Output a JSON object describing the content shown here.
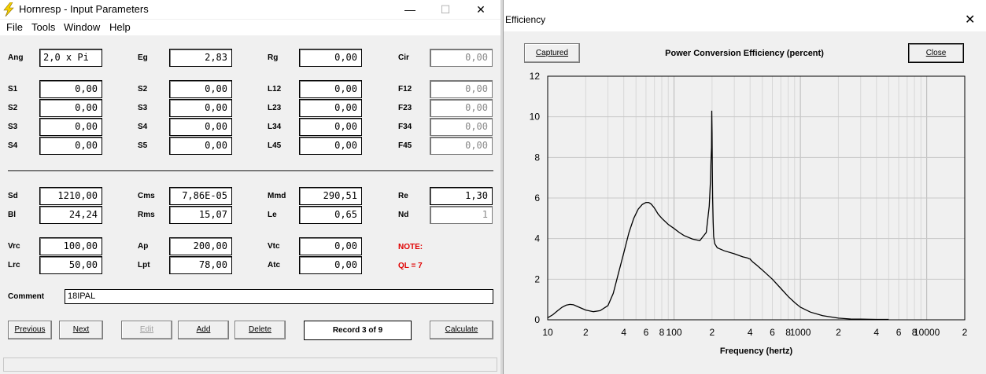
{
  "hornresp": {
    "title": "Hornresp - Input Parameters",
    "menu": [
      "File",
      "Tools",
      "Window",
      "Help"
    ],
    "controls": {
      "minimize": "—",
      "maximize": "☐",
      "close": "✕"
    },
    "rows": [
      {
        "cells": [
          {
            "label": "Ang",
            "value": "2,0 x Pi",
            "disabled": false,
            "left": true
          },
          {
            "label": "Eg",
            "value": "2,83",
            "disabled": false
          },
          {
            "label": "Rg",
            "value": "0,00",
            "disabled": false
          },
          {
            "label": "Cir",
            "value": "0,00",
            "disabled": true
          }
        ]
      },
      {
        "cells": [
          {
            "label": "S1",
            "value": "0,00",
            "disabled": false
          },
          {
            "label": "S2",
            "value": "0,00",
            "disabled": false
          },
          {
            "label": "L12",
            "value": "0,00",
            "disabled": false
          },
          {
            "label": "F12",
            "value": "0,00",
            "disabled": true
          }
        ]
      },
      {
        "cells": [
          {
            "label": "S2",
            "value": "0,00",
            "disabled": false
          },
          {
            "label": "S3",
            "value": "0,00",
            "disabled": false
          },
          {
            "label": "L23",
            "value": "0,00",
            "disabled": false
          },
          {
            "label": "F23",
            "value": "0,00",
            "disabled": true
          }
        ]
      },
      {
        "cells": [
          {
            "label": "S3",
            "value": "0,00",
            "disabled": false
          },
          {
            "label": "S4",
            "value": "0,00",
            "disabled": false
          },
          {
            "label": "L34",
            "value": "0,00",
            "disabled": false
          },
          {
            "label": "F34",
            "value": "0,00",
            "disabled": true
          }
        ]
      },
      {
        "cells": [
          {
            "label": "S4",
            "value": "0,00",
            "disabled": false
          },
          {
            "label": "S5",
            "value": "0,00",
            "disabled": false
          },
          {
            "label": "L45",
            "value": "0,00",
            "disabled": false
          },
          {
            "label": "F45",
            "value": "0,00",
            "disabled": true
          }
        ]
      },
      {
        "cells": [
          {
            "label": "Sd",
            "value": "1210,00",
            "disabled": false
          },
          {
            "label": "Cms",
            "value": "7,86E-05",
            "disabled": false
          },
          {
            "label": "Mmd",
            "value": "290,51",
            "disabled": false
          },
          {
            "label": "Re",
            "value": "1,30",
            "disabled": false
          }
        ]
      },
      {
        "cells": [
          {
            "label": "Bl",
            "value": "24,24",
            "disabled": false
          },
          {
            "label": "Rms",
            "value": "15,07",
            "disabled": false
          },
          {
            "label": "Le",
            "value": "0,65",
            "disabled": false
          },
          {
            "label": "Nd",
            "value": "1",
            "disabled": true
          }
        ]
      },
      {
        "cells": [
          {
            "label": "Vrc",
            "value": "100,00",
            "disabled": false
          },
          {
            "label": "Ap",
            "value": "200,00",
            "disabled": false
          },
          {
            "label": "Vtc",
            "value": "0,00",
            "disabled": false
          },
          {
            "label": "NOTE:",
            "note": true
          }
        ]
      },
      {
        "cells": [
          {
            "label": "Lrc",
            "value": "50,00",
            "disabled": false
          },
          {
            "label": "Lpt",
            "value": "78,00",
            "disabled": false
          },
          {
            "label": "Atc",
            "value": "0,00",
            "disabled": false
          },
          {
            "label": "QL = 7",
            "note": true
          }
        ]
      }
    ],
    "comment_label": "Comment",
    "comment_value": "18IPAL",
    "buttons": {
      "previous": "Previous",
      "next": "Next",
      "edit": "Edit",
      "add": "Add",
      "delete": "Delete",
      "calculate": "Calculate"
    },
    "record": "Record 3 of 9"
  },
  "efficiency": {
    "title": "Efficiency",
    "captured_label": "Captured",
    "close_label": "Close",
    "close_x": "✕"
  },
  "chart_data": {
    "type": "line",
    "title": "Power Conversion Efficiency (percent)",
    "xlabel": "Frequency (hertz)",
    "ylabel": "",
    "x_scale": "log",
    "xlim": [
      10,
      20000
    ],
    "ylim": [
      0,
      12
    ],
    "grid": true,
    "yticks": [
      0,
      2,
      4,
      6,
      8,
      10,
      12
    ],
    "xtick_labels": [
      {
        "value": 10,
        "label": "10"
      },
      {
        "value": 20,
        "label": "2"
      },
      {
        "value": 40,
        "label": "4"
      },
      {
        "value": 60,
        "label": "6"
      },
      {
        "value": 80,
        "label": "8"
      },
      {
        "value": 100,
        "label": "100"
      },
      {
        "value": 200,
        "label": "2"
      },
      {
        "value": 400,
        "label": "4"
      },
      {
        "value": 600,
        "label": "6"
      },
      {
        "value": 800,
        "label": "8"
      },
      {
        "value": 1000,
        "label": "1000"
      },
      {
        "value": 2000,
        "label": "2"
      },
      {
        "value": 4000,
        "label": "4"
      },
      {
        "value": 6000,
        "label": "6"
      },
      {
        "value": 8000,
        "label": "8"
      },
      {
        "value": 10000,
        "label": "10000"
      },
      {
        "value": 20000,
        "label": "2"
      }
    ],
    "series": [
      {
        "x": [
          10,
          11,
          12,
          13,
          14,
          15,
          16,
          18,
          20,
          23,
          26,
          30,
          33,
          36,
          40,
          44,
          48,
          52,
          56,
          60,
          63,
          66,
          70,
          75,
          80,
          90,
          100,
          110,
          120,
          140,
          160,
          180,
          190,
          194,
          196,
          198,
          199,
          200,
          201,
          202,
          204,
          206,
          210,
          220,
          250,
          300,
          350,
          380,
          395,
          400,
          405,
          420,
          450,
          500,
          600,
          700,
          800,
          900,
          1000,
          1200,
          1500,
          2000,
          2500,
          3000,
          4000,
          5000
        ],
        "y": [
          0.1,
          0.25,
          0.45,
          0.62,
          0.72,
          0.76,
          0.74,
          0.6,
          0.48,
          0.4,
          0.45,
          0.7,
          1.3,
          2.2,
          3.3,
          4.3,
          5.0,
          5.45,
          5.68,
          5.78,
          5.78,
          5.7,
          5.5,
          5.2,
          5.0,
          4.7,
          4.5,
          4.3,
          4.15,
          3.98,
          3.9,
          4.3,
          5.6,
          6.8,
          7.8,
          8.5,
          10.3,
          9.2,
          7.5,
          6.0,
          4.8,
          4.1,
          3.75,
          3.55,
          3.4,
          3.25,
          3.1,
          3.05,
          3.0,
          3.0,
          2.95,
          2.85,
          2.7,
          2.45,
          2.0,
          1.55,
          1.15,
          0.85,
          0.62,
          0.38,
          0.2,
          0.08,
          0.04,
          0.03,
          0.02,
          0.02
        ]
      }
    ]
  }
}
